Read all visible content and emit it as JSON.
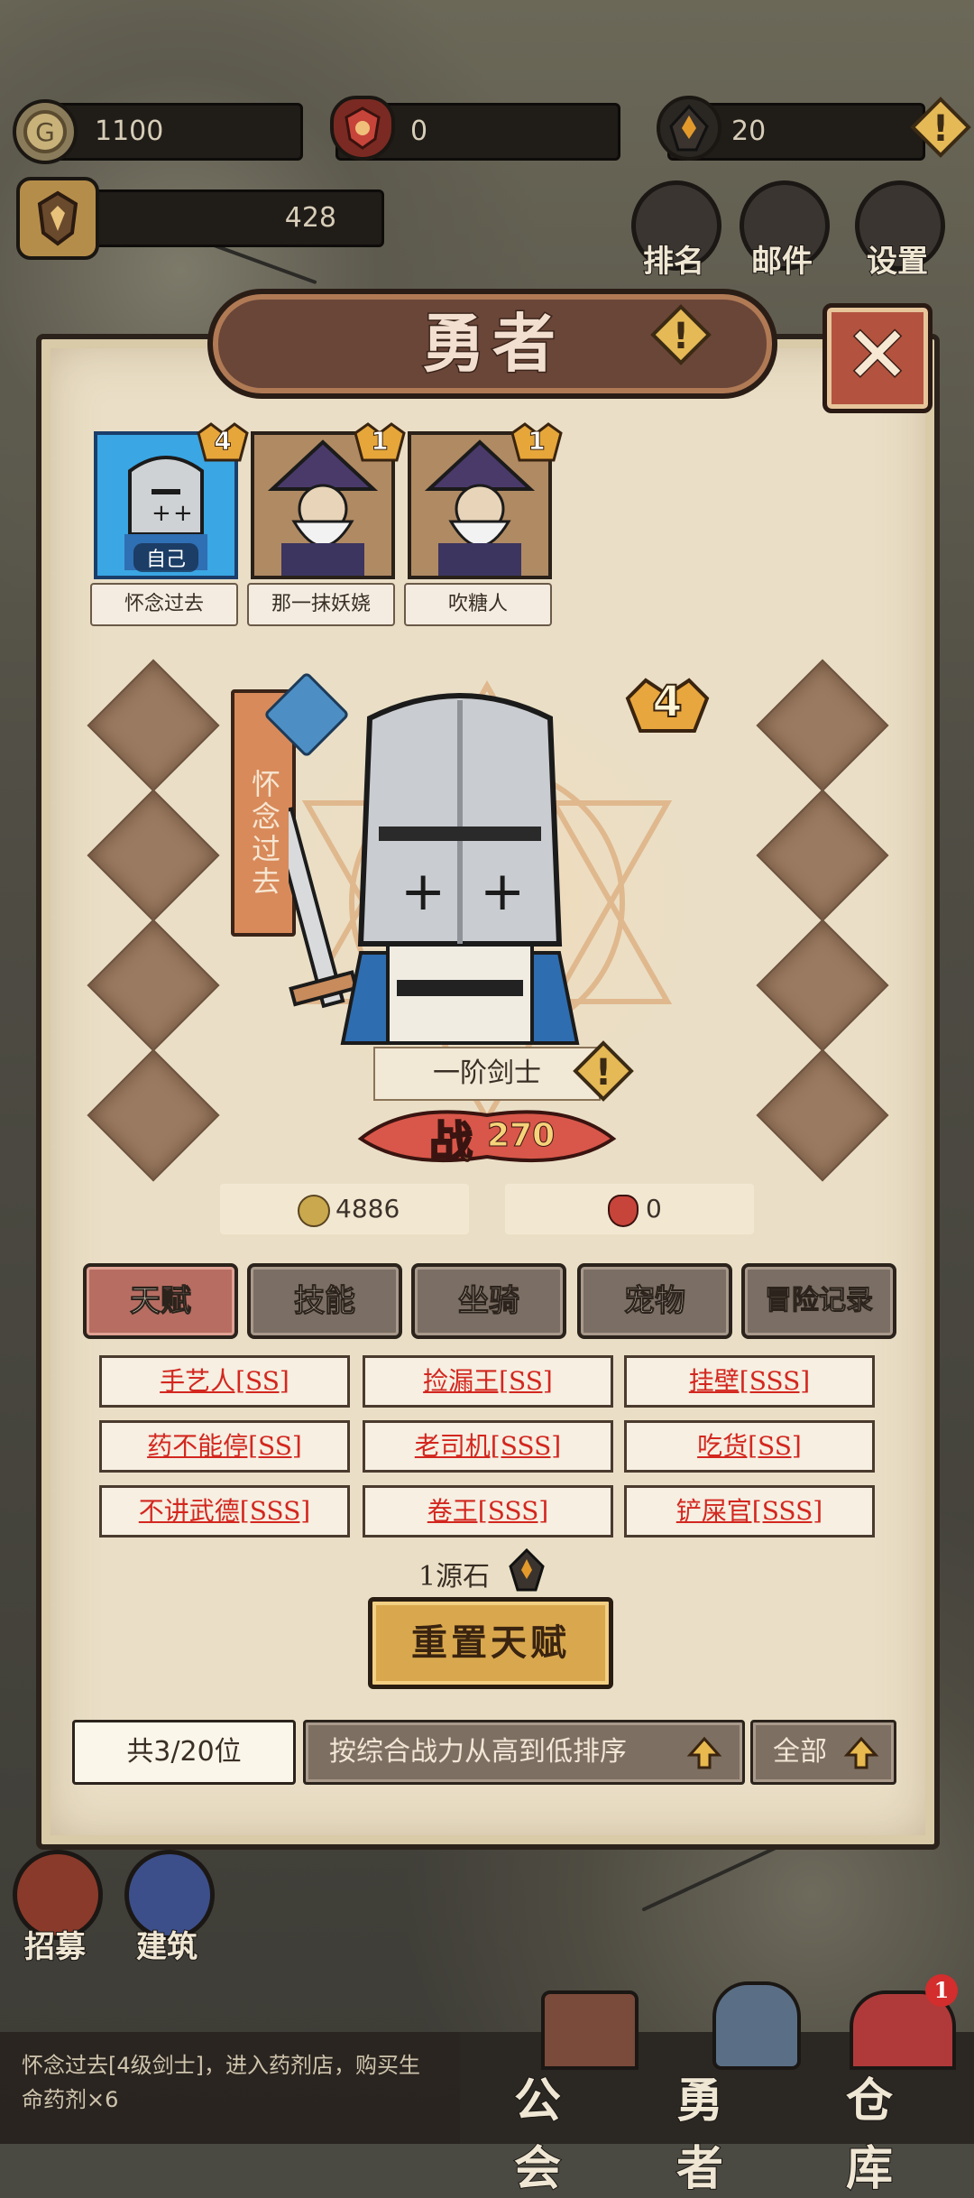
{
  "topbar": {
    "gold": "1100",
    "badge_count": "0",
    "source_stone": "20",
    "power_total": "428"
  },
  "nav": {
    "ranking": "排名",
    "mail": "邮件",
    "settings": "设置"
  },
  "dialog": {
    "title": "勇者",
    "close_symbol": "✕"
  },
  "heroes": [
    {
      "name": "怀念过去",
      "tag": "自己",
      "rank": "4"
    },
    {
      "name": "那一抹妖娆",
      "rank": "1"
    },
    {
      "name": "吹糖人",
      "rank": "1"
    }
  ],
  "hero_detail": {
    "name_vertical": "怀念过去",
    "rank": "4",
    "class": "一阶剑士",
    "combat_label": "战",
    "combat_power": "270",
    "gold": "4886",
    "badge": "0"
  },
  "tabs": [
    "天赋",
    "技能",
    "坐骑",
    "宠物",
    "冒险记录"
  ],
  "talents": [
    "手艺人[SS]",
    "捡漏王[SS]",
    "挂壁[SSS]",
    "药不能停[SS]",
    "老司机[SSS]",
    "吃货[SS]",
    "不讲武德[SSS]",
    "卷王[SSS]",
    "铲屎官[SSS]"
  ],
  "reset": {
    "cost": "1源石",
    "button": "重置天赋"
  },
  "footer": {
    "count": "共3/20位",
    "sort": "按综合战力从高到低排序",
    "filter": "全部"
  },
  "side": {
    "recruit": "招募",
    "build": "建筑"
  },
  "log": "怀念过去[4级剑士]，进入药剂店，购买生命药剂×6",
  "bottom_nav": {
    "guild": "公会",
    "hero": "勇者",
    "warehouse": "仓库",
    "warehouse_badge": "1"
  },
  "colors": {
    "accent": "#b76d62",
    "talent_red": "#d3271f",
    "panel": "#eadfc6",
    "gold_button": "#d9a84e"
  }
}
